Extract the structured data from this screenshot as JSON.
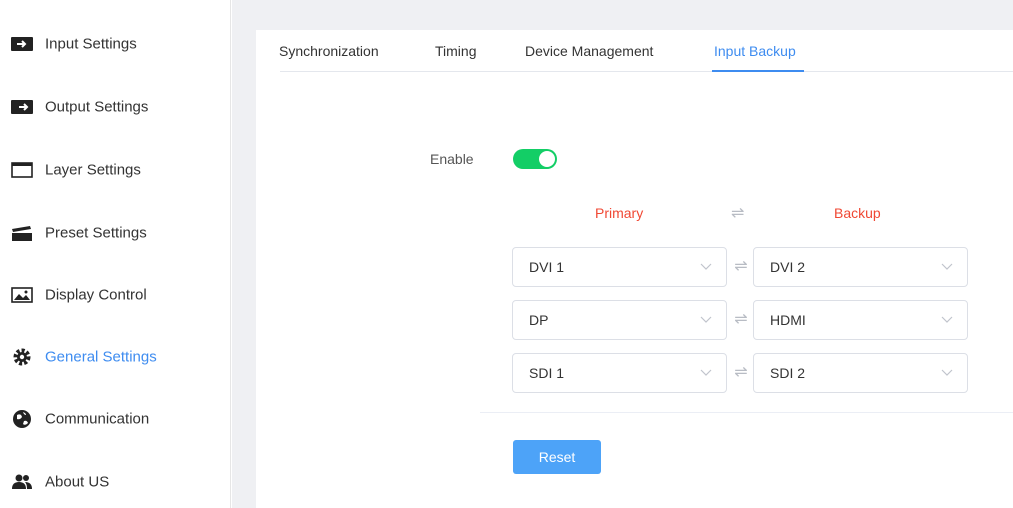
{
  "sidebar": {
    "items": [
      {
        "label": "Input Settings",
        "icon": "input-icon"
      },
      {
        "label": "Output Settings",
        "icon": "output-icon"
      },
      {
        "label": "Layer Settings",
        "icon": "window-icon"
      },
      {
        "label": "Preset Settings",
        "icon": "clapperboard-icon"
      },
      {
        "label": "Display Control",
        "icon": "image-icon"
      },
      {
        "label": "General Settings",
        "icon": "gear-icon",
        "active": true
      },
      {
        "label": "Communication",
        "icon": "globe-icon"
      },
      {
        "label": "About US",
        "icon": "users-icon"
      }
    ]
  },
  "tabs": [
    {
      "label": "Synchronization"
    },
    {
      "label": "Timing"
    },
    {
      "label": "Device Management"
    },
    {
      "label": "Input Backup",
      "active": true
    }
  ],
  "backup": {
    "enable_label": "Enable",
    "enabled": true,
    "primary_header": "Primary",
    "backup_header": "Backup",
    "swap_symbol": "⇌",
    "pairs": [
      {
        "primary": "DVI 1",
        "backup": "DVI 2"
      },
      {
        "primary": "DP",
        "backup": "HDMI"
      },
      {
        "primary": "SDI 1",
        "backup": "SDI 2"
      }
    ],
    "reset_label": "Reset"
  },
  "colors": {
    "accent": "#3e8cf0",
    "toggle_on": "#13ce66",
    "header_red": "#f04834",
    "button": "#4da3f8"
  }
}
